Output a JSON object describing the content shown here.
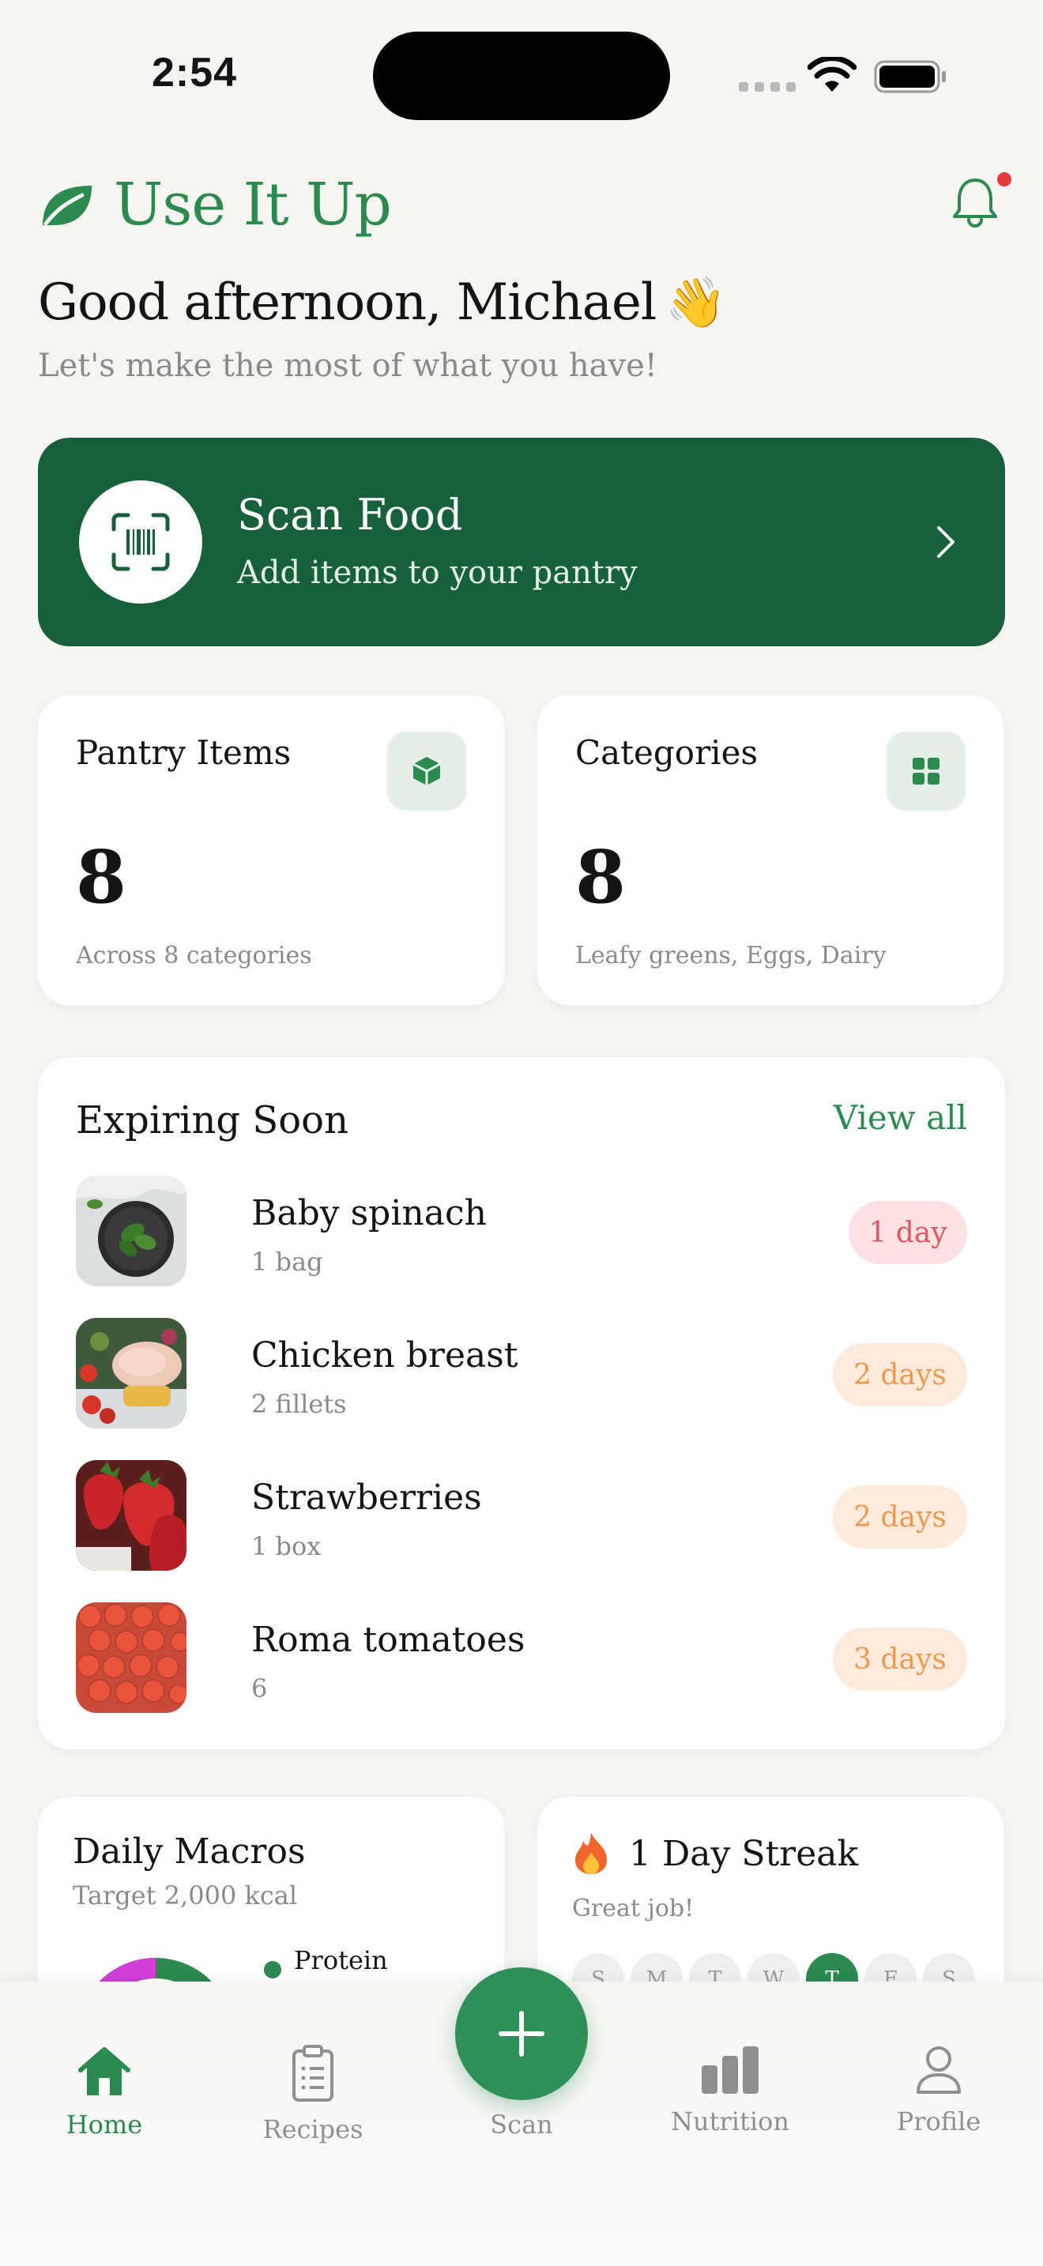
{
  "status": {
    "time": "2:54"
  },
  "header": {
    "app_name": "Use It Up"
  },
  "greeting": {
    "title": "Good afternoon, Michael",
    "emoji": "👋",
    "subtitle": "Let's make the most of what you have!"
  },
  "scan": {
    "title": "Scan Food",
    "subtitle": "Add items to your pantry"
  },
  "stats": {
    "pantry": {
      "title": "Pantry Items",
      "value": "8",
      "sub": "Across 8 categories"
    },
    "categories": {
      "title": "Categories",
      "value": "8",
      "sub": "Leafy greens, Eggs, Dairy"
    }
  },
  "expiring": {
    "title": "Expiring Soon",
    "view_all": "View all",
    "items": [
      {
        "name": "Baby spinach",
        "qty": "1 bag",
        "badge": "1 day"
      },
      {
        "name": "Chicken breast",
        "qty": "2 fillets",
        "badge": "2 days"
      },
      {
        "name": "Strawberries",
        "qty": "1 box",
        "badge": "2 days"
      },
      {
        "name": "Roma tomatoes",
        "qty": "6",
        "badge": "3 days"
      }
    ]
  },
  "macros": {
    "title": "Daily Macros",
    "subtitle": "Target 2,000 kcal",
    "legend_protein": "Protein"
  },
  "streak": {
    "title": "1 Day Streak",
    "subtitle": "Great job!",
    "days": [
      "S",
      "M",
      "T",
      "W",
      "T",
      "F",
      "S"
    ]
  },
  "tabs": {
    "home": "Home",
    "recipes": "Recipes",
    "scan": "Scan",
    "nutrition": "Nutrition",
    "profile": "Profile"
  },
  "colors": {
    "brand": "#2b8a4e",
    "scan_card": "#17603a",
    "urgent": "#e05565",
    "warn": "#ee9a4e"
  }
}
